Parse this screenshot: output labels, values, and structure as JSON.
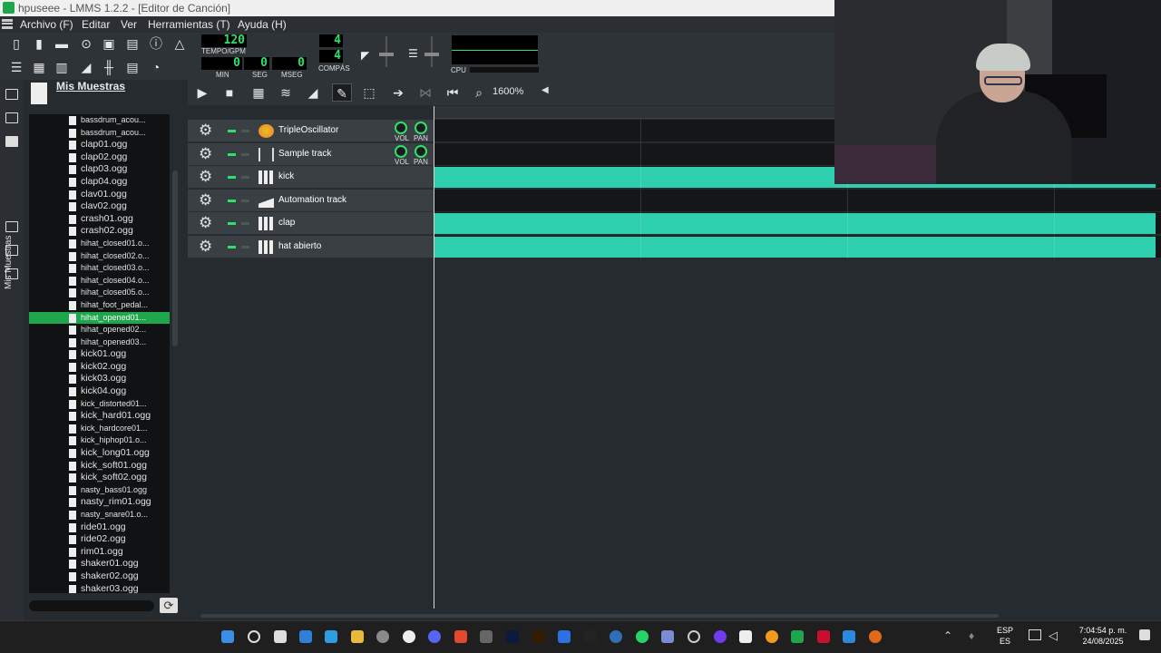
{
  "window": {
    "title": "hpuseee - LMMS 1.2.2 - [Editor de Canción]"
  },
  "menu": [
    "Archivo (F)",
    "Editar",
    "Ver",
    "Herramientas (T)",
    "Ayuda (H)"
  ],
  "transport": {
    "tempo": "120",
    "tempo_label": "TEMPO/GPM",
    "min": "0",
    "min_label": "MIN",
    "seg": "0",
    "seg_label": "SEG",
    "mseg": "0",
    "mseg_label": "MSEG",
    "time_sig_num": "4",
    "time_sig_den": "4",
    "time_sig_label": "COMPÁS",
    "cpu_label": "CPU"
  },
  "browser": {
    "title": "Mis Muestras",
    "tab_label": "Mis Muestras",
    "files": [
      "bassdrum_acou...",
      "bassdrum_acou...",
      "clap01.ogg",
      "clap02.ogg",
      "clap03.ogg",
      "clap04.ogg",
      "clav01.ogg",
      "clav02.ogg",
      "crash01.ogg",
      "crash02.ogg",
      "hihat_closed01.o...",
      "hihat_closed02.o...",
      "hihat_closed03.o...",
      "hihat_closed04.o...",
      "hihat_closed05.o...",
      "hihat_foot_pedal...",
      "hihat_opened01...",
      "hihat_opened02...",
      "hihat_opened03...",
      "kick01.ogg",
      "kick02.ogg",
      "kick03.ogg",
      "kick04.ogg",
      "kick_distorted01...",
      "kick_hard01.ogg",
      "kick_hardcore01...",
      "kick_hiphop01.o...",
      "kick_long01.ogg",
      "kick_soft01.ogg",
      "kick_soft02.ogg",
      "nasty_bass01.ogg",
      "nasty_rim01.ogg",
      "nasty_snare01.o...",
      "ride01.ogg",
      "ride02.ogg",
      "rim01.ogg",
      "shaker01.ogg",
      "shaker02.ogg",
      "shaker03.ogg"
    ],
    "selected_index": 16
  },
  "song_editor": {
    "zoom": "1600%",
    "bar_marker": "2",
    "vol_label": "VOL",
    "pan_label": "PAN",
    "tracks": [
      {
        "name": "TripleOscillator",
        "type": "instrument",
        "has_pattern": false
      },
      {
        "name": "Sample track",
        "type": "sample",
        "has_pattern": false
      },
      {
        "name": "kick",
        "type": "beat",
        "has_pattern": true
      },
      {
        "name": "Automation track",
        "type": "automation",
        "has_pattern": false
      },
      {
        "name": "clap",
        "type": "beat",
        "has_pattern": true
      },
      {
        "name": "hat abierto",
        "type": "beat",
        "has_pattern": true
      }
    ],
    "accent": "#2ecfaf"
  },
  "taskbar": {
    "lang": "ESP",
    "lang_sub": "ES",
    "time": "7:04:54 p. m.",
    "date": "24/08/2025"
  }
}
